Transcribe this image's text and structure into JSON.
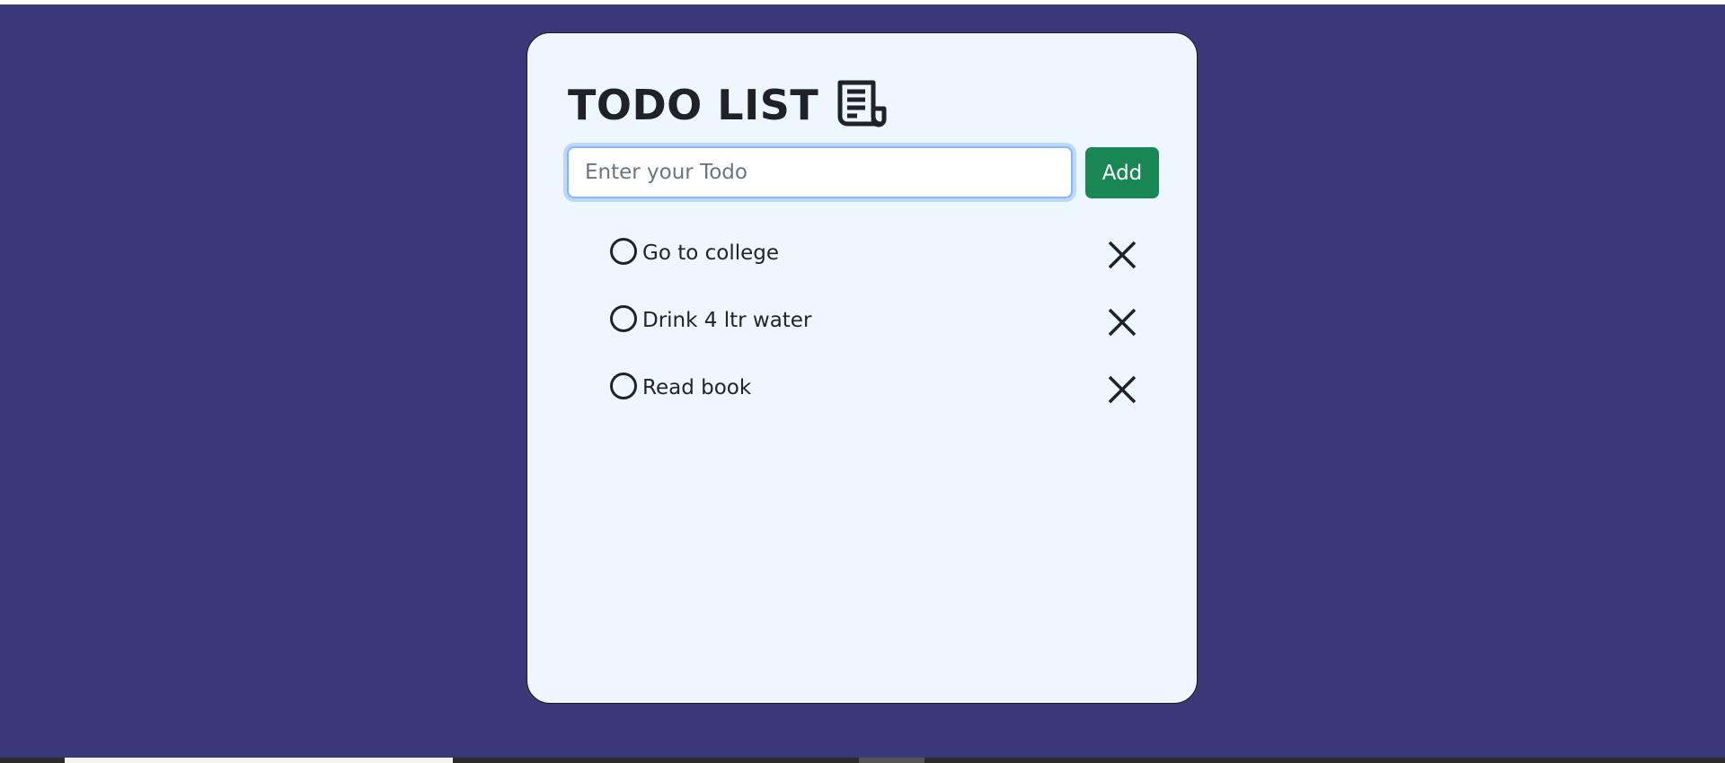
{
  "app": {
    "title": "TODO LIST",
    "title_icon": "receipt-icon"
  },
  "input": {
    "placeholder": "Enter your Todo",
    "value": ""
  },
  "add_button": {
    "label": "Add",
    "color": "#198754"
  },
  "todos": [
    {
      "text": "Go to college",
      "done": false
    },
    {
      "text": "Drink 4 ltr water",
      "done": false
    },
    {
      "text": "Read book",
      "done": false
    }
  ],
  "icons": {
    "check": "circle-icon",
    "delete": "close-icon"
  },
  "colors": {
    "background": "#393979",
    "card": "#eef6ff",
    "text": "#212529"
  }
}
